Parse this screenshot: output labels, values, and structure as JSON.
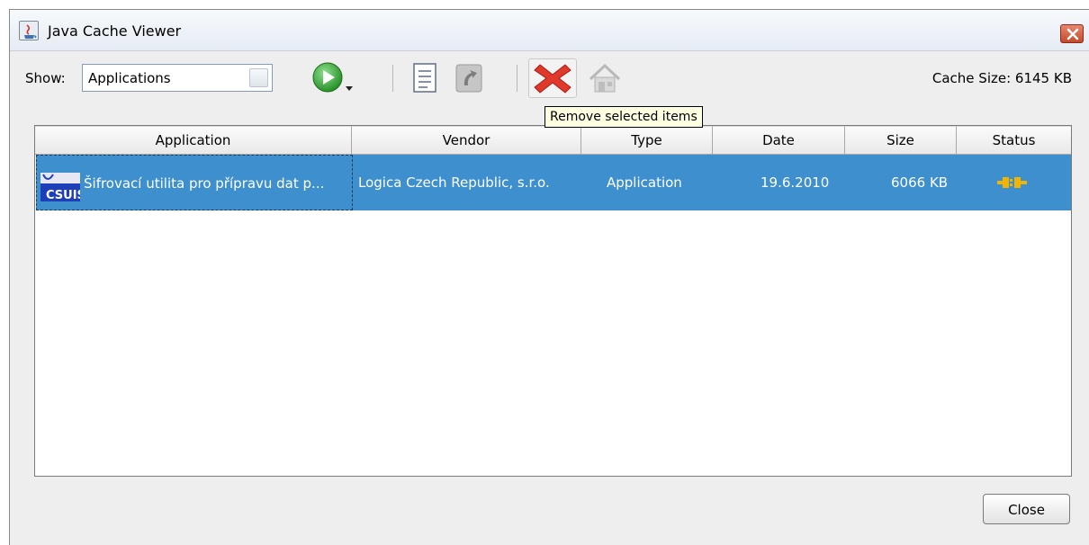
{
  "window": {
    "title": "Java Cache Viewer"
  },
  "toolbar": {
    "show_label": "Show:",
    "show_value": "Applications",
    "cache_size_label": "Cache Size:",
    "cache_size_value": "6145 KB",
    "buttons": [
      "run-icon",
      "details-icon",
      "install-shortcut-icon",
      "remove-icon",
      "home-icon"
    ]
  },
  "tooltip": {
    "text": "Remove selected items"
  },
  "table": {
    "columns": [
      "Application",
      "Vendor",
      "Type",
      "Date",
      "Size",
      "Status"
    ],
    "rows": [
      {
        "application": "Šifrovací utilita pro přípravu dat p...",
        "vendor": "Logica Czech Republic, s.r.o.",
        "type": "Application",
        "date": "19.6.2010",
        "size": "6066 KB",
        "status_icon": "connection-plug-icon"
      }
    ]
  },
  "app_logo_text": "CSUIS",
  "footer": {
    "close_label": "Close"
  },
  "colors": {
    "selection": "#3e8fce",
    "tooltip_bg": "#ffffe1",
    "remove_red": "#e0392b",
    "run_green": "#2f9e2f"
  }
}
